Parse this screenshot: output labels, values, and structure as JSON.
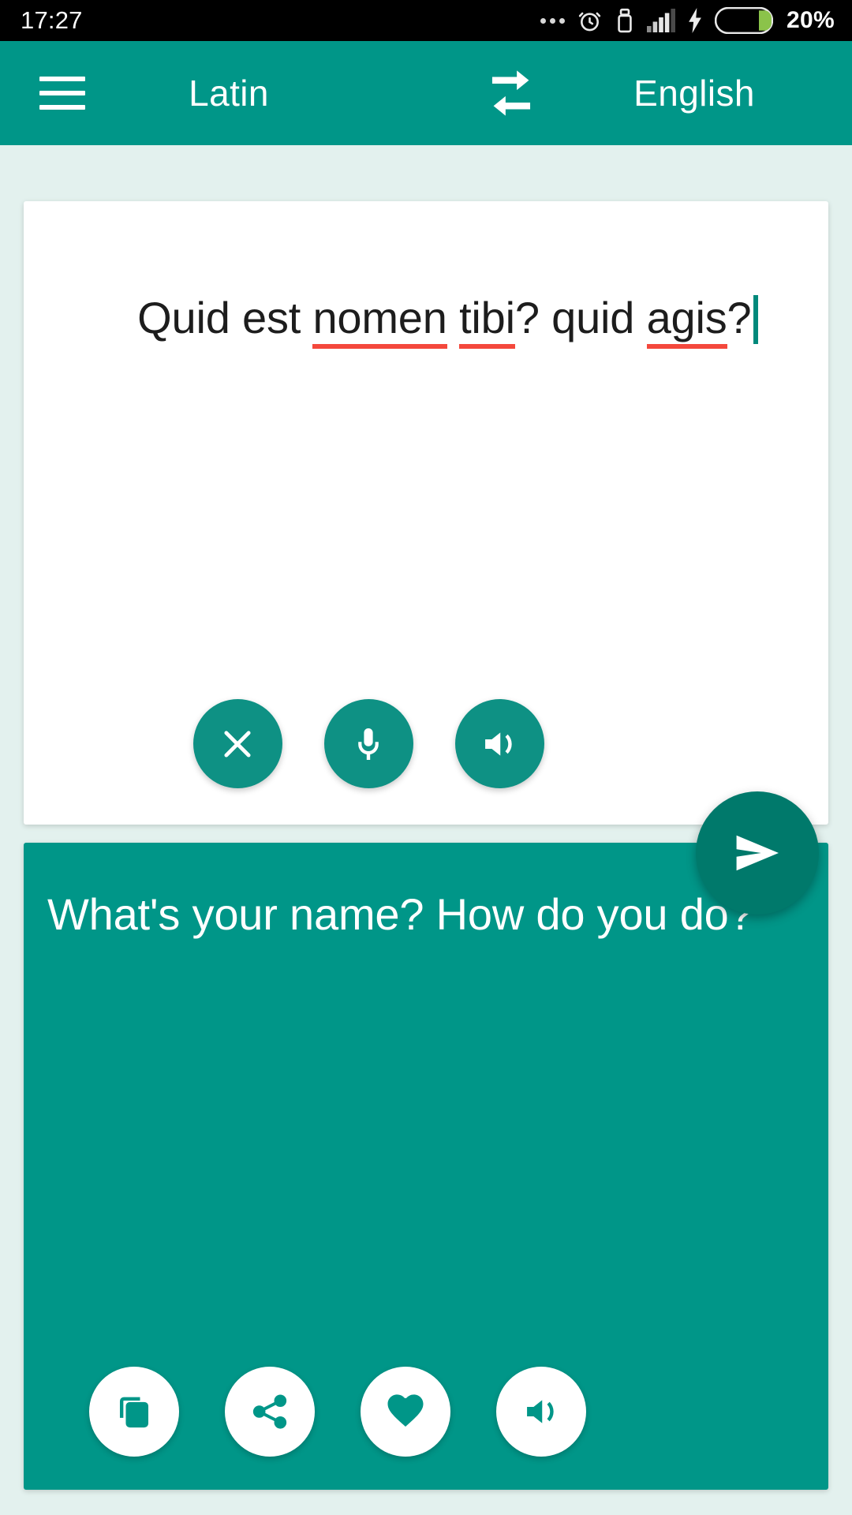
{
  "status_bar": {
    "clock": "17:27",
    "battery_percent": "20%",
    "battery_level": 20,
    "icons": [
      "more-dots-icon",
      "alarm-clock-icon",
      "usb-icon",
      "signal-bars-icon",
      "charging-bolt-icon",
      "battery-icon"
    ]
  },
  "toolbar": {
    "menu_icon": "hamburger-menu-icon",
    "source_language": "Latin",
    "swap_icon": "swap-languages-icon",
    "target_language": "English",
    "background_color": "#009688"
  },
  "source": {
    "text_segments": [
      {
        "text": "Quid est ",
        "misspelled": false
      },
      {
        "text": "nomen",
        "misspelled": true
      },
      {
        "text": " ",
        "misspelled": false
      },
      {
        "text": "tibi",
        "misspelled": true
      },
      {
        "text": "? quid ",
        "misspelled": false
      },
      {
        "text": "agis",
        "misspelled": true
      },
      {
        "text": "?",
        "misspelled": false
      }
    ],
    "full_text": "Quid est nomen tibi? quid agis?",
    "caret_visible": true,
    "spellcheck_color": "#F4483C",
    "buttons": [
      {
        "name": "clear-button",
        "icon": "close-x-icon"
      },
      {
        "name": "microphone-button",
        "icon": "microphone-icon"
      },
      {
        "name": "speak-source-button",
        "icon": "speaker-icon"
      }
    ]
  },
  "send": {
    "name": "send-translate-button",
    "icon": "send-paper-plane-icon",
    "color": "#00796B"
  },
  "result": {
    "text": "What's your name? How do you do?",
    "background_color": "#009688",
    "buttons": [
      {
        "name": "copy-button",
        "icon": "copy-icon"
      },
      {
        "name": "share-button",
        "icon": "share-icon"
      },
      {
        "name": "favorite-button",
        "icon": "heart-icon"
      },
      {
        "name": "speak-result-button",
        "icon": "speaker-icon"
      }
    ]
  },
  "page": {
    "background_color": "#E3F1EE"
  }
}
